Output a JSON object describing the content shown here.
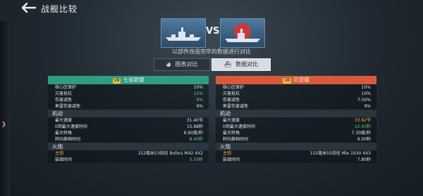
{
  "header": {
    "title": "战舰比较"
  },
  "compare": {
    "vs": "VS",
    "subtitle": "以部件改造完毕的数据进行对比"
  },
  "tabs": [
    {
      "label": "图表对比"
    },
    {
      "label": "数据对比"
    }
  ],
  "colors": {
    "left_header": "#2f9d80",
    "right_header": "#d85a3a",
    "accent_green": "#5fd37b",
    "accent_orange": "#f5b33b"
  },
  "left": {
    "tier": "Ⅷ",
    "name": "七省联盟",
    "top_rows": [
      {
        "label": "核心区保护",
        "value": "10%"
      },
      {
        "label": "灾害抵抗",
        "value": "15%"
      },
      {
        "label": "伤害减免",
        "value": "9%"
      },
      {
        "label": "鱼雷伤害减免",
        "value": "9%"
      }
    ],
    "section_maneuver": "机动",
    "maneuver_rows": [
      {
        "label": "最大速度",
        "value": "31.40节"
      },
      {
        "label": "0到最大速度时间",
        "value": "15.68秒"
      },
      {
        "label": "最大转角",
        "value": "6.90度/秒"
      },
      {
        "label": "转向换档时间",
        "value": "8.40秒"
      }
    ],
    "section_firepower": "火炮",
    "firepower_rows": [
      {
        "label": "主炮",
        "value": "152毫米53倍径 Bofors M42 4X2"
      },
      {
        "label": "装填时间",
        "value": "5.50秒"
      }
    ]
  },
  "right": {
    "tier": "Ⅷ",
    "name": "贝亚德",
    "top_rows": [
      {
        "label": "核心区保护",
        "value": "10%"
      },
      {
        "label": "灾害抵抗",
        "value": "10%"
      },
      {
        "label": "伤害减免",
        "value": "7.50%"
      },
      {
        "label": "鱼雷伤害减免",
        "value": "9%"
      }
    ],
    "section_maneuver": "机动",
    "maneuver_rows": [
      {
        "label": "最大速度",
        "value": "33.62节"
      },
      {
        "label": "0到最大速度时间",
        "value": "12.43秒"
      },
      {
        "label": "最大转角",
        "value": "7.30度/秒"
      },
      {
        "label": "转向换档时间",
        "value": "9.00秒"
      }
    ],
    "section_firepower": "火炮",
    "firepower_rows": [
      {
        "label": "主炮",
        "value": "152毫米55倍径 Mle 1930 4X3"
      },
      {
        "label": "装填时间",
        "value": "7.80秒"
      }
    ]
  }
}
